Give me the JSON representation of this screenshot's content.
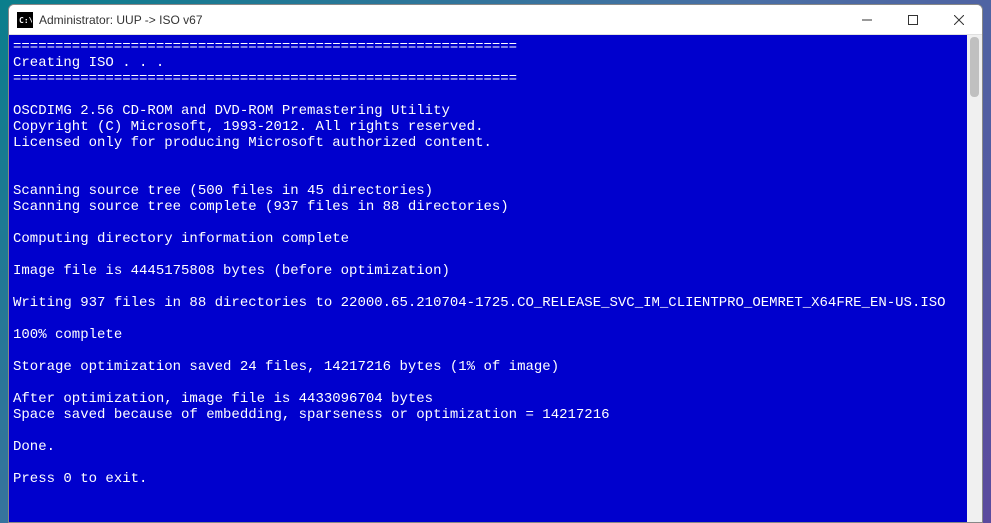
{
  "window": {
    "title": "Administrator:  UUP -> ISO v67",
    "icon_label": "cmd"
  },
  "terminal": {
    "lines": [
      "============================================================",
      "Creating ISO . . .",
      "============================================================",
      "",
      "OSCDIMG 2.56 CD-ROM and DVD-ROM Premastering Utility",
      "Copyright (C) Microsoft, 1993-2012. All rights reserved.",
      "Licensed only for producing Microsoft authorized content.",
      "",
      "",
      "Scanning source tree (500 files in 45 directories)",
      "Scanning source tree complete (937 files in 88 directories)",
      "",
      "Computing directory information complete",
      "",
      "Image file is 4445175808 bytes (before optimization)",
      "",
      "Writing 937 files in 88 directories to 22000.65.210704-1725.CO_RELEASE_SVC_IM_CLIENTPRO_OEMRET_X64FRE_EN-US.ISO",
      "",
      "100% complete",
      "",
      "Storage optimization saved 24 files, 14217216 bytes (1% of image)",
      "",
      "After optimization, image file is 4433096704 bytes",
      "Space saved because of embedding, sparseness or optimization = 14217216",
      "",
      "Done.",
      "",
      "Press 0 to exit."
    ]
  }
}
